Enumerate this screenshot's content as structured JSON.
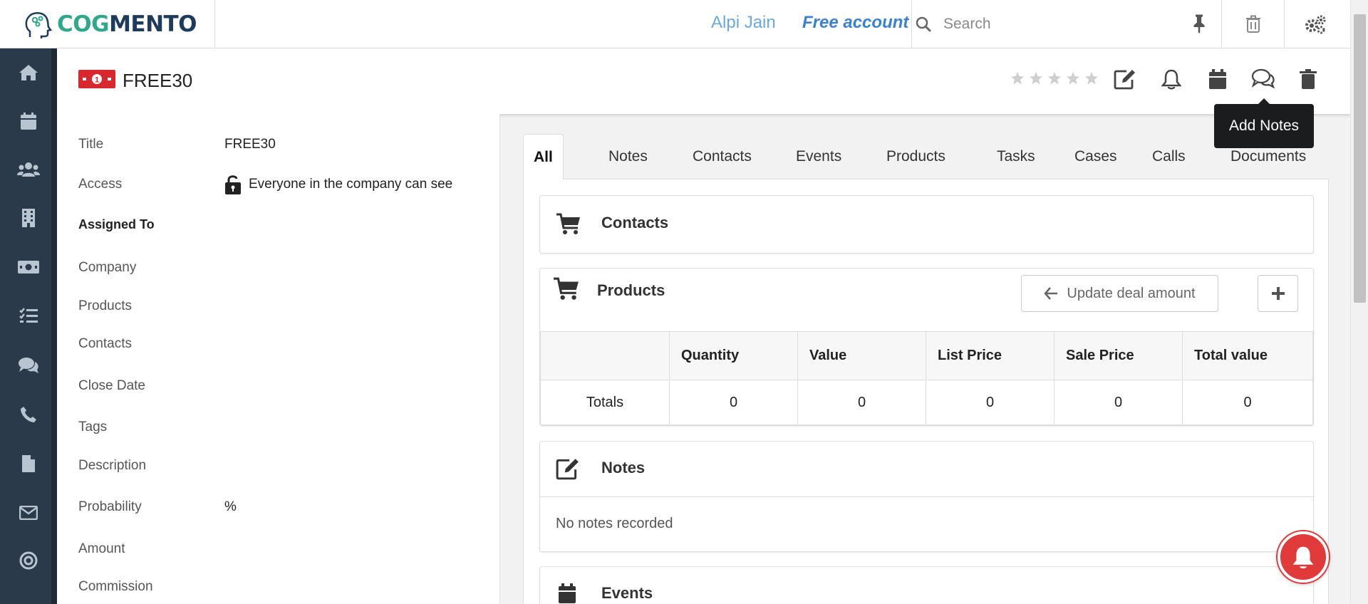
{
  "topbar": {
    "logo_cog": "COG",
    "logo_mento": "MENTO",
    "user_name": "Alpi Jain",
    "account_type": "Free account",
    "search_placeholder": "Search"
  },
  "sidebar": {
    "items": [
      {
        "icon": "home-icon"
      },
      {
        "icon": "calendar-icon"
      },
      {
        "icon": "contacts-icon"
      },
      {
        "icon": "company-icon"
      },
      {
        "icon": "deals-icon"
      },
      {
        "icon": "tasks-icon"
      },
      {
        "icon": "chat-icon"
      },
      {
        "icon": "phone-icon"
      },
      {
        "icon": "document-icon"
      },
      {
        "icon": "email-icon"
      },
      {
        "icon": "target-icon"
      }
    ]
  },
  "deal": {
    "title": "FREE30",
    "rating": 0,
    "rating_max": 5,
    "tooltip": "Add Notes"
  },
  "details": {
    "fields": [
      {
        "label": "Title",
        "value": "FREE30"
      },
      {
        "label": "Access",
        "value": "Everyone in the company can see"
      },
      {
        "label": "Assigned To",
        "value": ""
      },
      {
        "label": "Company",
        "value": ""
      },
      {
        "label": "Products",
        "value": ""
      },
      {
        "label": "Contacts",
        "value": ""
      },
      {
        "label": "Close Date",
        "value": ""
      },
      {
        "label": "Tags",
        "value": ""
      },
      {
        "label": "Description",
        "value": ""
      },
      {
        "label": "Probability",
        "value": "%"
      },
      {
        "label": "Amount",
        "value": ""
      },
      {
        "label": "Commission",
        "value": ""
      }
    ]
  },
  "tabs": [
    "All",
    "Notes",
    "Contacts",
    "Events",
    "Products",
    "Tasks",
    "Cases",
    "Calls",
    "Documents"
  ],
  "active_tab": "All",
  "cards": {
    "contacts_title": "Contacts",
    "products_title": "Products",
    "update_deal_label": "Update deal amount",
    "notes_title": "Notes",
    "notes_empty": "No notes recorded",
    "events_title": "Events"
  },
  "products_table": {
    "headers": [
      "",
      "Quantity",
      "Value",
      "List Price",
      "Sale Price",
      "Total value"
    ],
    "totals_row": [
      "Totals",
      "0",
      "0",
      "0",
      "0",
      "0"
    ]
  },
  "colors": {
    "sidebar": "#2b3a4a",
    "deal_icon": "#d9272e",
    "accent_blue": "#3a82cf",
    "bell": "#e03a3a"
  }
}
